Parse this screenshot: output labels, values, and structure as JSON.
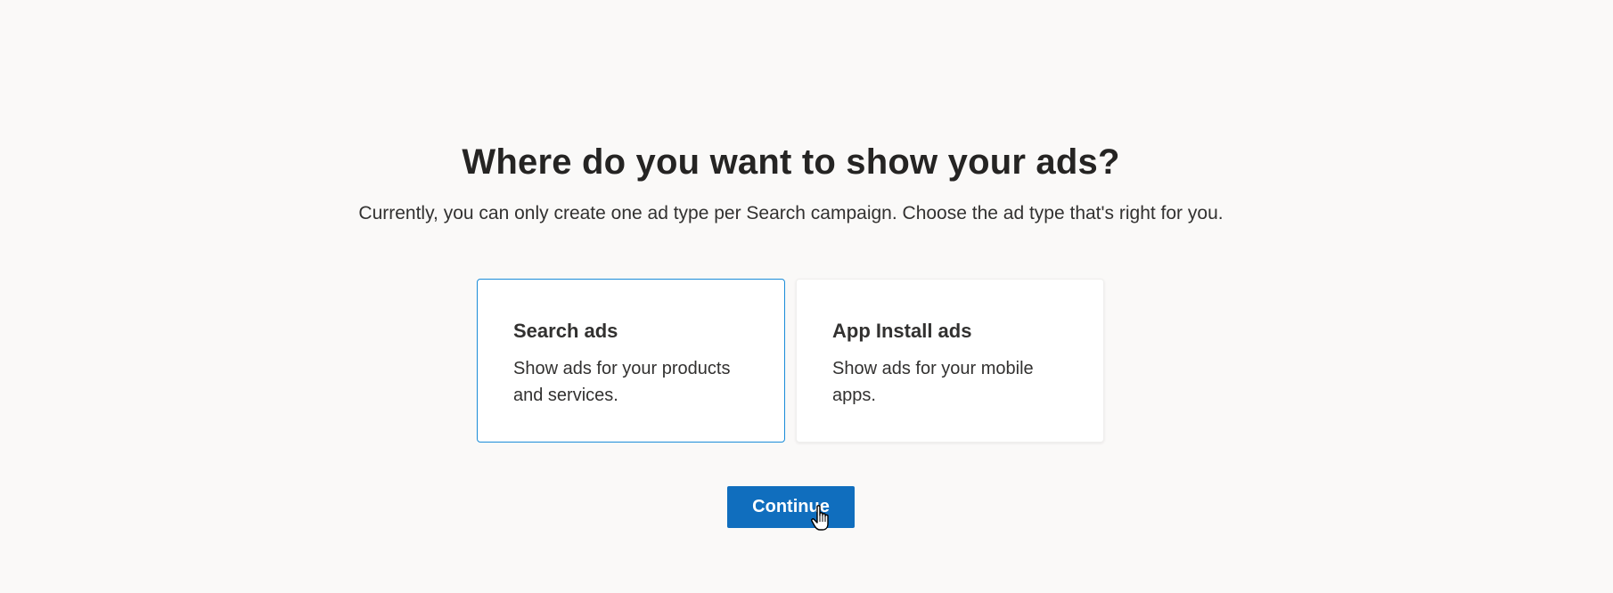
{
  "header": {
    "title": "Where do you want to show your ads?",
    "subtitle": "Currently, you can only create one ad type per Search campaign. Choose the ad type that's right for you."
  },
  "options": [
    {
      "title": "Search ads",
      "description": "Show ads for your products and services.",
      "selected": true
    },
    {
      "title": "App Install ads",
      "description": "Show ads for your mobile apps.",
      "selected": false
    }
  ],
  "actions": {
    "continue_label": "Continue"
  },
  "colors": {
    "background": "#faf9f8",
    "accent": "#106ebe",
    "selected_border": "#1a8cd8"
  },
  "icons": {
    "cursor": "hand-pointer-icon"
  }
}
